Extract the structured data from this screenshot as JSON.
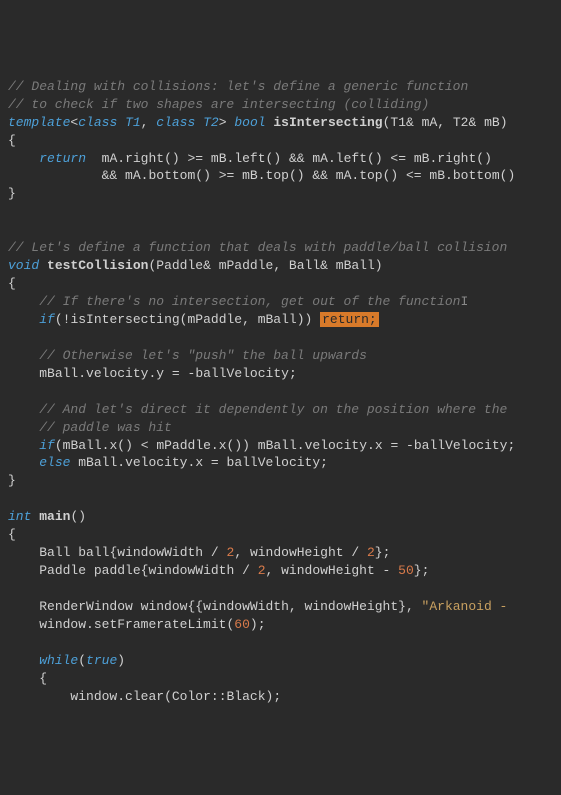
{
  "code": {
    "c1": "// Dealing with collisions: let's define a generic function",
    "c2": "// to check if two shapes are intersecting (colliding)",
    "kw_template": "template",
    "kw_class1": "class",
    "t_T1": "T1",
    "kw_class2": "class",
    "t_T2": "T2",
    "kw_bool": "bool",
    "fn_isIntersecting": "isIntersecting",
    "p_T1": "T1",
    "amp1": "&",
    "p_mA": "mA",
    "p_T2": "T2",
    "amp2": "&",
    "p_mB": "mB",
    "lbrace1": "{",
    "kw_return1": "return",
    "expr_r1a": "mA",
    "dot1": ".",
    "call_right1": "right",
    "op_ge1": ">=",
    "expr_r1b": "mB",
    "call_left1": "left",
    "op_and1": "&&",
    "expr_r1c": "mA",
    "call_left2": "left",
    "op_le1": "<=",
    "expr_r1d": "mB",
    "call_right2": "right",
    "op_and2": "&&",
    "expr_r2a": "mA",
    "call_bottom1": "bottom",
    "op_ge2": ">=",
    "expr_r2b": "mB",
    "call_top1": "top",
    "op_and3": "&&",
    "expr_r2c": "mA",
    "call_top2": "top",
    "op_le2": "<=",
    "expr_r2d": "mB",
    "call_bottom2": "bottom",
    "rbrace1": "}",
    "c3": "// Let's define a function that deals with paddle/ball collision",
    "kw_void": "void",
    "fn_testCollision": "testCollision",
    "t_Paddle": "Paddle",
    "amp3": "&",
    "p_mPaddle": "mPaddle",
    "t_Ball": "Ball",
    "amp4": "&",
    "p_mBall": "mBall",
    "lbrace2": "{",
    "c4": "// If there's no intersection, get out of the function",
    "kw_if1": "if",
    "bang": "!",
    "call_isInt": "isIntersecting",
    "arg_mPaddle": "mPaddle",
    "arg_mBall": "mBall",
    "kw_return2": "return;",
    "c5": "// Otherwise let's \"push\" the ball upwards",
    "s_mBall1": "mBall",
    "s_vel1": "velocity",
    "s_y": "y",
    "s_eq1": " = ",
    "s_neg1": "-",
    "s_bv1": "ballVelocity",
    "c6": "// And let's direct it dependently on the position where the",
    "c7": "// paddle was hit",
    "kw_if2": "if",
    "s_mBall2": "mBall",
    "call_x1": "x",
    "op_lt": "<",
    "s_mPaddle2": "mPaddle",
    "call_x2": "x",
    "s_mBall3": "mBall",
    "s_vel2": "velocity",
    "s_x2": "x",
    "s_eq2": " = ",
    "s_neg2": "-",
    "s_bv2": "ballVelocity",
    "kw_else": "else",
    "s_mBall4": "mBall",
    "s_vel3": "velocity",
    "s_x3": "x",
    "s_eq3": " = ",
    "s_bv3": "ballVelocity",
    "rbrace2": "}",
    "kw_int": "int",
    "fn_main": "main",
    "lbrace3": "{",
    "t_Ball2": "Ball",
    "v_ball": "ball",
    "v_ww1": "windowWidth",
    "op_div1": " / ",
    "n_2a": "2",
    "v_wh1": "windowHeight",
    "op_div2": " / ",
    "n_2b": "2",
    "t_Paddle2": "Paddle",
    "v_paddle": "paddle",
    "v_ww2": "windowWidth",
    "op_div3": " / ",
    "n_2c": "2",
    "v_wh2": "windowHeight",
    "op_sub": " - ",
    "n_50": "50",
    "t_RW": "RenderWindow",
    "v_window": "window",
    "v_ww3": "windowWidth",
    "v_wh3": "windowHeight",
    "str_ark": "\"Arkanoid -",
    "v_window2": "window",
    "call_sfl": "setFramerateLimit",
    "n_60": "60",
    "kw_while": "while",
    "kw_true": "true",
    "lbrace4": "{",
    "v_window3": "window",
    "call_clear": "clear",
    "t_Color": "Color",
    "scope": "::",
    "v_Black": "Black",
    "cursor": "I"
  }
}
